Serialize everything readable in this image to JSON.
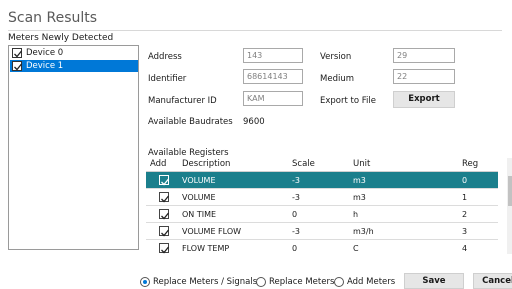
{
  "window": {
    "title": "Scan Results"
  },
  "meters": {
    "header": "Meters Newly Detected",
    "devices": [
      {
        "label": "Device 0",
        "checked": true,
        "selected": false
      },
      {
        "label": "Device 1",
        "checked": true,
        "selected": true
      }
    ]
  },
  "details": {
    "address_label": "Address",
    "address_value": "143",
    "version_label": "Version",
    "version_value": "29",
    "identifier_label": "Identifier",
    "identifier_value": "68614143",
    "medium_label": "Medium",
    "medium_value": "22",
    "manufacturer_label": "Manufacturer ID",
    "manufacturer_value": "KAM",
    "export_label": "Export to File",
    "export_button": "Export",
    "baudrates_label": "Available Baudrates",
    "baudrates_value": "9600"
  },
  "registers": {
    "title": "Available Registers",
    "columns": {
      "add": "Add",
      "description": "Description",
      "scale": "Scale",
      "unit": "Unit",
      "reg": "Reg"
    },
    "rows": [
      {
        "checked": true,
        "description": "VOLUME",
        "scale": "-3",
        "unit": "m3",
        "reg": "0",
        "selected": true
      },
      {
        "checked": true,
        "description": "VOLUME",
        "scale": "-3",
        "unit": "m3",
        "reg": "1",
        "selected": false
      },
      {
        "checked": true,
        "description": "ON TIME",
        "scale": "0",
        "unit": "h",
        "reg": "2",
        "selected": false
      },
      {
        "checked": true,
        "description": "VOLUME FLOW",
        "scale": "-3",
        "unit": "m3/h",
        "reg": "3",
        "selected": false
      },
      {
        "checked": true,
        "description": "FLOW TEMP",
        "scale": "0",
        "unit": "C",
        "reg": "4",
        "selected": false
      }
    ]
  },
  "footer": {
    "options": [
      {
        "label": "Replace Meters / Signals",
        "selected": true
      },
      {
        "label": "Replace Meters",
        "selected": false
      },
      {
        "label": "Add Meters",
        "selected": false
      }
    ],
    "save": "Save",
    "cancel": "Cancel"
  },
  "colors": {
    "selection": "#0078d7",
    "row_selection": "#1b7f8c"
  }
}
